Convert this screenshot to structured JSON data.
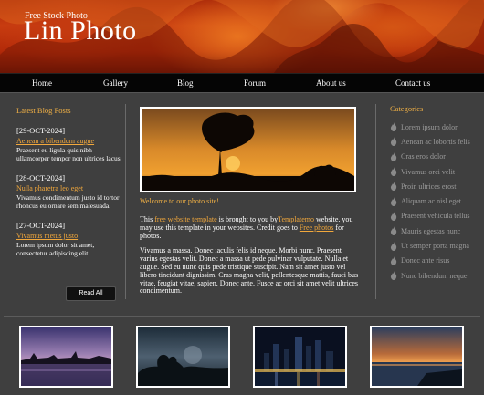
{
  "site": {
    "tagline": "Free Stock Photo",
    "title": "Lin Photo"
  },
  "nav": [
    "Home",
    "Gallery",
    "Blog",
    "Forum",
    "About us",
    "Contact us"
  ],
  "blog": {
    "heading": "Latest Blog Posts",
    "posts": [
      {
        "date": "[29-OCT-2024]",
        "title": "Aenean a bibendum augue",
        "excerpt": "Praesent eu ligula quis nibh ullamcorper tempor non ultrices lacus"
      },
      {
        "date": "[28-OCT-2024]",
        "title": "Nulla pharetra leo eget",
        "excerpt": "Vivamus condimentum justo id tortor rhoncus eu ornare sem malesuada."
      },
      {
        "date": "[27-OCT-2024]",
        "title": "Vivamus metus justo",
        "excerpt": "Lorem ipsum dolor sit amet, consectetur adipiscing elit"
      }
    ],
    "read_all": "Read All"
  },
  "main": {
    "welcome": "Welcome to our photo site!",
    "intro": {
      "t1": "This ",
      "link1": "free website template",
      "t2": " is brought to you by",
      "link2": "Templatemo",
      "t3": " website. you may use this template in your websites. Credit goes to ",
      "link3": "Free photos",
      "t4": " for photos."
    },
    "body": "Vivamus a massa. Donec iaculis felis id neque. Morbi nunc. Praesent varius egestas velit. Donec a massa ut pede pulvinar vulputate. Nulla et augue. Sed eu nunc quis pede tristique suscipit. Nam sit amet justo vel libero tincidunt dignissim. Cras magna velit, pellentesque mattis, fauci bus vitae, feugiat vitae, sapien. Donec ante. Fusce ac orci sit amet velit ultrices condimentum."
  },
  "categories": {
    "heading": "Categories",
    "items": [
      "Lorem ipsum dolor",
      "Aenean ac lobortis felis",
      "Cras eros dolor",
      "Vivamus orci velit",
      "Proin ultrices erost",
      "Aliquam ac nisl eget",
      "Praesent vehicula tellus",
      "Mauris egestas nunc",
      "Ut semper porta magna",
      "Donec ante risus",
      "Nunc bibendum neque"
    ]
  },
  "colors": {
    "accent": "#f0b045",
    "link": "#f2a83c",
    "background": "#3f3f3f",
    "nav": "#050505"
  }
}
